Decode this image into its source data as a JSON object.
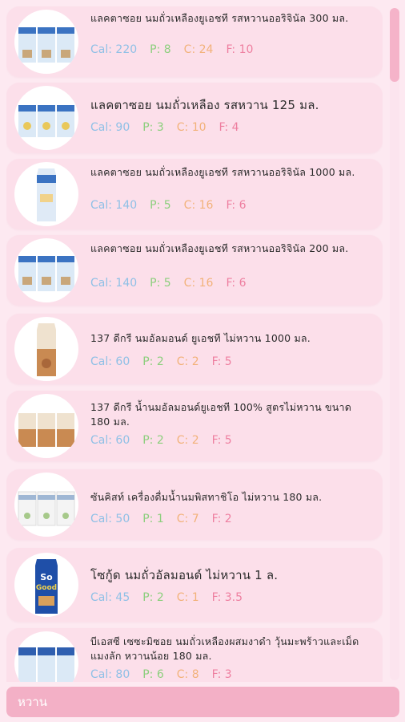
{
  "items": [
    {
      "name": "แลคตาซอย นมถั่วเหลืองยูเอชที รสหวานออริจินัล 300 มล.",
      "cal": "Cal: 220",
      "p": "P: 8",
      "c": "C: 24",
      "f": "F: 10",
      "image": "carton-pack-blue"
    },
    {
      "name": "แลคตาซอย นมถั่วเหลือง รสหวาน 125 มล.",
      "cal": "Cal: 90",
      "p": "P: 3",
      "c": "C: 10",
      "f": "F: 4",
      "image": "carton-pack-blue"
    },
    {
      "name": "แลคตาซอย นมถั่วเหลืองยูเอชที รสหวานออริจินัล 1000 มล.",
      "cal": "Cal: 140",
      "p": "P: 5",
      "c": "C: 16",
      "f": "F: 6",
      "image": "carton-tall-blue"
    },
    {
      "name": "แลคตาซอย นมถั่วเหลืองยูเอชที รสหวานออริจินัล 200 มล.",
      "cal": "Cal: 140",
      "p": "P: 5",
      "c": "C: 16",
      "f": "F: 6",
      "image": "carton-pack-blue"
    },
    {
      "name": "137 ดีกรี นมอัลมอนด์ ยูเอชที ไม่หวาน 1000 มล.",
      "cal": "Cal: 60",
      "p": "P: 2",
      "c": "C: 2",
      "f": "F: 5",
      "image": "carton-tall-almond"
    },
    {
      "name": "137 ดีกรี น้ำนมอัลมอนด์ยูเอชที 100% สูตรไม่หวาน ขนาด 180 มล.",
      "cal": "Cal: 60",
      "p": "P: 2",
      "c": "C: 2",
      "f": "F: 5",
      "image": "carton-pack-almond"
    },
    {
      "name": "ซันคิสท์ เครื่องดื่มน้ำนมพิสทาชิโอ ไม่หวาน 180 มล.",
      "cal": "Cal: 50",
      "p": "P: 1",
      "c": "C: 7",
      "f": "F: 2",
      "image": "carton-pack-white"
    },
    {
      "name": "โซกู้ด นมถั่วอัลมอนด์ ไม่หวาน 1 ล.",
      "cal": "Cal: 45",
      "p": "P: 2",
      "c": "C: 1",
      "f": "F: 3.5",
      "image": "carton-tall-sogood"
    },
    {
      "name": "บีเอสซี เซซะมิซอย นมถั่วเหลืองผสมงาดำ วุ้นมะพร้าวและเม็ดแมงลัก หวานน้อย 180 มล.",
      "cal": "Cal: 80",
      "p": "P: 6",
      "c": "C: 8",
      "f": "F: 3",
      "image": "carton-pack-blue"
    }
  ],
  "category_bar": {
    "label": "หวาน"
  },
  "colors": {
    "cal": "#8fc0e6",
    "protein": "#8ccf7d",
    "carb": "#f2b27a",
    "fat": "#ee7fa0",
    "card": "#fcdfea",
    "accent": "#f3b0c6"
  }
}
